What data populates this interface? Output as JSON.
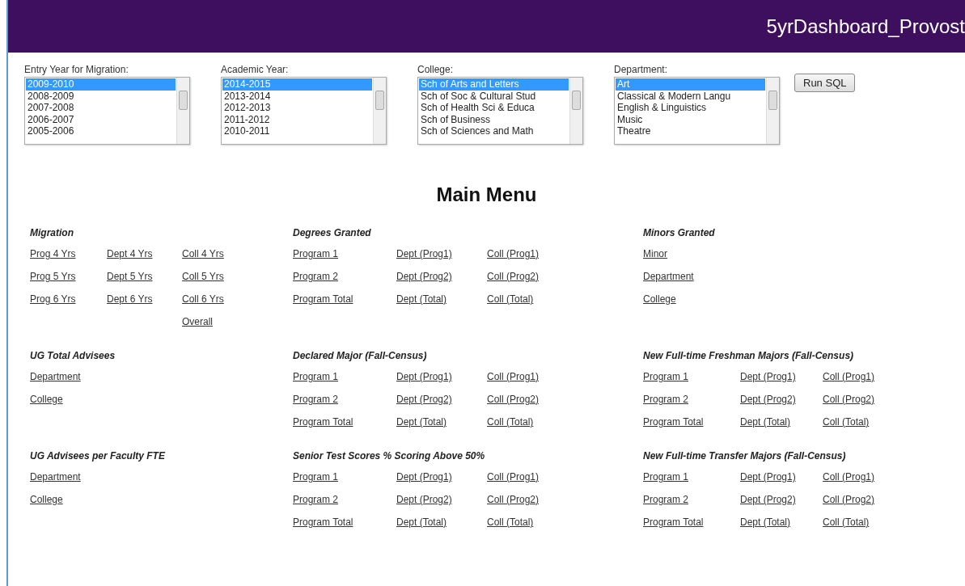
{
  "header": {
    "title": "5yrDashboard_Provost"
  },
  "filters": [
    {
      "label": "Entry Year for Migration:",
      "options": [
        {
          "text": "2009-2010",
          "selected": true
        },
        {
          "text": "2008-2009",
          "selected": false
        },
        {
          "text": "2007-2008",
          "selected": false
        },
        {
          "text": "2006-2007",
          "selected": false
        },
        {
          "text": "2005-2006",
          "selected": false
        }
      ]
    },
    {
      "label": "Academic Year:",
      "options": [
        {
          "text": "2014-2015",
          "selected": true
        },
        {
          "text": "2013-2014",
          "selected": false
        },
        {
          "text": "2012-2013",
          "selected": false
        },
        {
          "text": "2011-2012",
          "selected": false
        },
        {
          "text": "2010-2011",
          "selected": false
        }
      ]
    },
    {
      "label": "College:",
      "options": [
        {
          "text": "Sch of Arts and Letters",
          "selected": true
        },
        {
          "text": "Sch of Soc & Cultural Stud",
          "selected": false
        },
        {
          "text": "Sch of Health Sci & Educa",
          "selected": false
        },
        {
          "text": "Sch of Business",
          "selected": false
        },
        {
          "text": "Sch of Sciences and Math",
          "selected": false
        }
      ]
    },
    {
      "label": "Department:",
      "options": [
        {
          "text": "Art",
          "selected": true
        },
        {
          "text": "Classical & Modern Langu",
          "selected": false
        },
        {
          "text": "English & Linguistics",
          "selected": false
        },
        {
          "text": "Music",
          "selected": false
        },
        {
          "text": "Theatre",
          "selected": false
        }
      ]
    }
  ],
  "run_button": "Run SQL",
  "menu_title": "Main Menu",
  "sections": [
    {
      "title": "Migration",
      "rows": [
        [
          "Prog 4 Yrs",
          "Dept 4 Yrs",
          "Coll 4 Yrs"
        ],
        [
          "Prog 5 Yrs",
          "Dept 5 Yrs",
          "Coll 5 Yrs"
        ],
        [
          "Prog 6 Yrs",
          "Dept 6 Yrs",
          "Coll 6 Yrs"
        ],
        [
          null,
          null,
          "Overall"
        ]
      ]
    },
    {
      "title": "Degrees Granted",
      "rows": [
        [
          "Program 1",
          "Dept (Prog1)",
          "Coll (Prog1)"
        ],
        [
          "Program 2",
          "Dept (Prog2)",
          "Coll (Prog2)"
        ],
        [
          "Program Total",
          "Dept (Total)",
          "Coll (Total)"
        ]
      ]
    },
    {
      "title": "Minors Granted",
      "rows": [
        [
          "Minor"
        ],
        [
          "Department"
        ],
        [
          "College"
        ]
      ]
    },
    {
      "title": "UG Total Advisees",
      "rows": [
        [
          "Department"
        ],
        [
          "College"
        ]
      ]
    },
    {
      "title": "Declared Major (Fall-Census)",
      "rows": [
        [
          "Program 1",
          "Dept (Prog1)",
          "Coll (Prog1)"
        ],
        [
          "Program 2",
          "Dept (Prog2)",
          "Coll (Prog2)"
        ],
        [
          "Program Total",
          "Dept (Total)",
          "Coll (Total)"
        ]
      ]
    },
    {
      "title": "New Full-time Freshman Majors (Fall-Census)",
      "rows": [
        [
          "Program 1",
          "Dept (Prog1)",
          "Coll (Prog1)"
        ],
        [
          "Program 2",
          "Dept (Prog2)",
          "Coll (Prog2)"
        ],
        [
          "Program Total",
          "Dept (Total)",
          "Coll (Total)"
        ]
      ]
    },
    {
      "title": "UG Advisees per Faculty FTE",
      "rows": [
        [
          "Department"
        ],
        [
          "College"
        ]
      ]
    },
    {
      "title": "Senior Test Scores % Scoring Above 50%",
      "rows": [
        [
          "Program 1",
          "Dept (Prog1)",
          "Coll (Prog1)"
        ],
        [
          "Program 2",
          "Dept (Prog2)",
          "Coll (Prog2)"
        ],
        [
          "Program Total",
          "Dept (Total)",
          "Coll (Total)"
        ]
      ]
    },
    {
      "title": "New Full-time Transfer Majors (Fall-Census)",
      "rows": [
        [
          "Program 1",
          "Dept (Prog1)",
          "Coll (Prog1)"
        ],
        [
          "Program 2",
          "Dept (Prog2)",
          "Coll (Prog2)"
        ],
        [
          "Program Total",
          "Dept (Total)",
          "Coll (Total)"
        ]
      ]
    }
  ]
}
